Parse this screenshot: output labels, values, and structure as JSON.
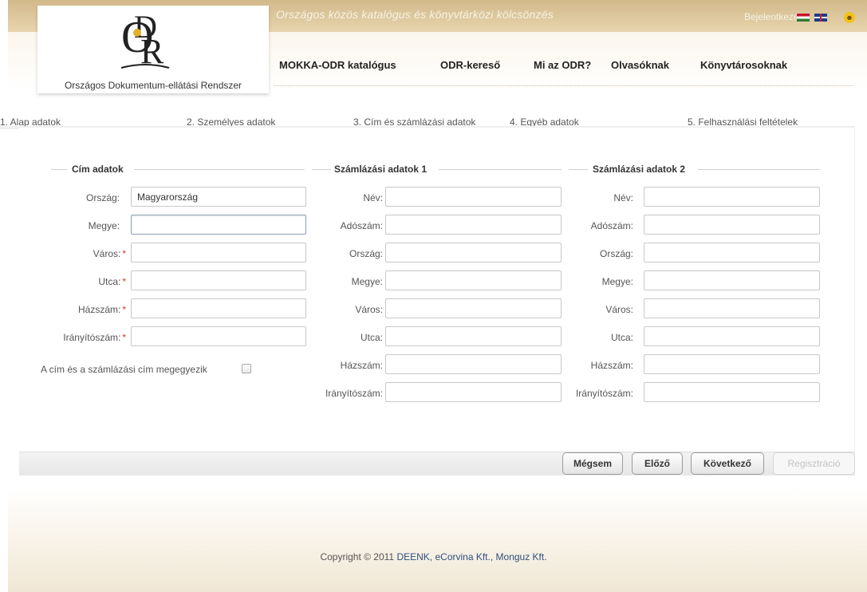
{
  "header": {
    "subtitle": "Országos közös katalógus és könyvtárközi kölcsönzés",
    "login": "Bejelentkezés",
    "logo_text": "Országos Dokumentum-ellátási Rendszer",
    "languages": [
      "hu",
      "en"
    ]
  },
  "nav": {
    "items": [
      "MOKKA-ODR katalógus",
      "ODR-kereső",
      "Mi az ODR?",
      "Olvasóknak",
      "Könyvtárosoknak"
    ]
  },
  "steps": [
    "1. Alap adatok",
    "2. Személyes adatok",
    "3. Cím és számlázási adatok",
    "4. Egyéb adatok",
    "5. Felhasználási feltételek"
  ],
  "address": {
    "title": "Cím adatok",
    "country_label": "Ország:",
    "country_value": "Magyarország",
    "county_label": "Megye:",
    "county_value": "",
    "city_label": "Város:",
    "street_label": "Utca:",
    "house_label": "Házszám:",
    "zip_label": "Irányítószám:",
    "required_mark": "*",
    "same_address_label": "A cím és a számlázási cím megegyezik"
  },
  "billing1": {
    "title": "Számlázási adatok 1",
    "labels": [
      "Név:",
      "Adószám:",
      "Ország:",
      "Megye:",
      "Város:",
      "Utca:",
      "Házszám:",
      "Irányítószám:"
    ]
  },
  "billing2": {
    "title": "Számlázási adatok 2",
    "labels": [
      "Név:",
      "Adószám:",
      "Ország:",
      "Megye:",
      "Város:",
      "Utca:",
      "Házszám:",
      "Irányítószám:"
    ]
  },
  "buttons": {
    "cancel": "Mégsem",
    "prev": "Előző",
    "next": "Következő",
    "register": "Regisztráció"
  },
  "footer": {
    "copyright": "Copyright © 2011",
    "deenk": "DEENK,",
    "ecorvina": "eCorvina Kft.,",
    "monguz": "Monguz Kft."
  }
}
